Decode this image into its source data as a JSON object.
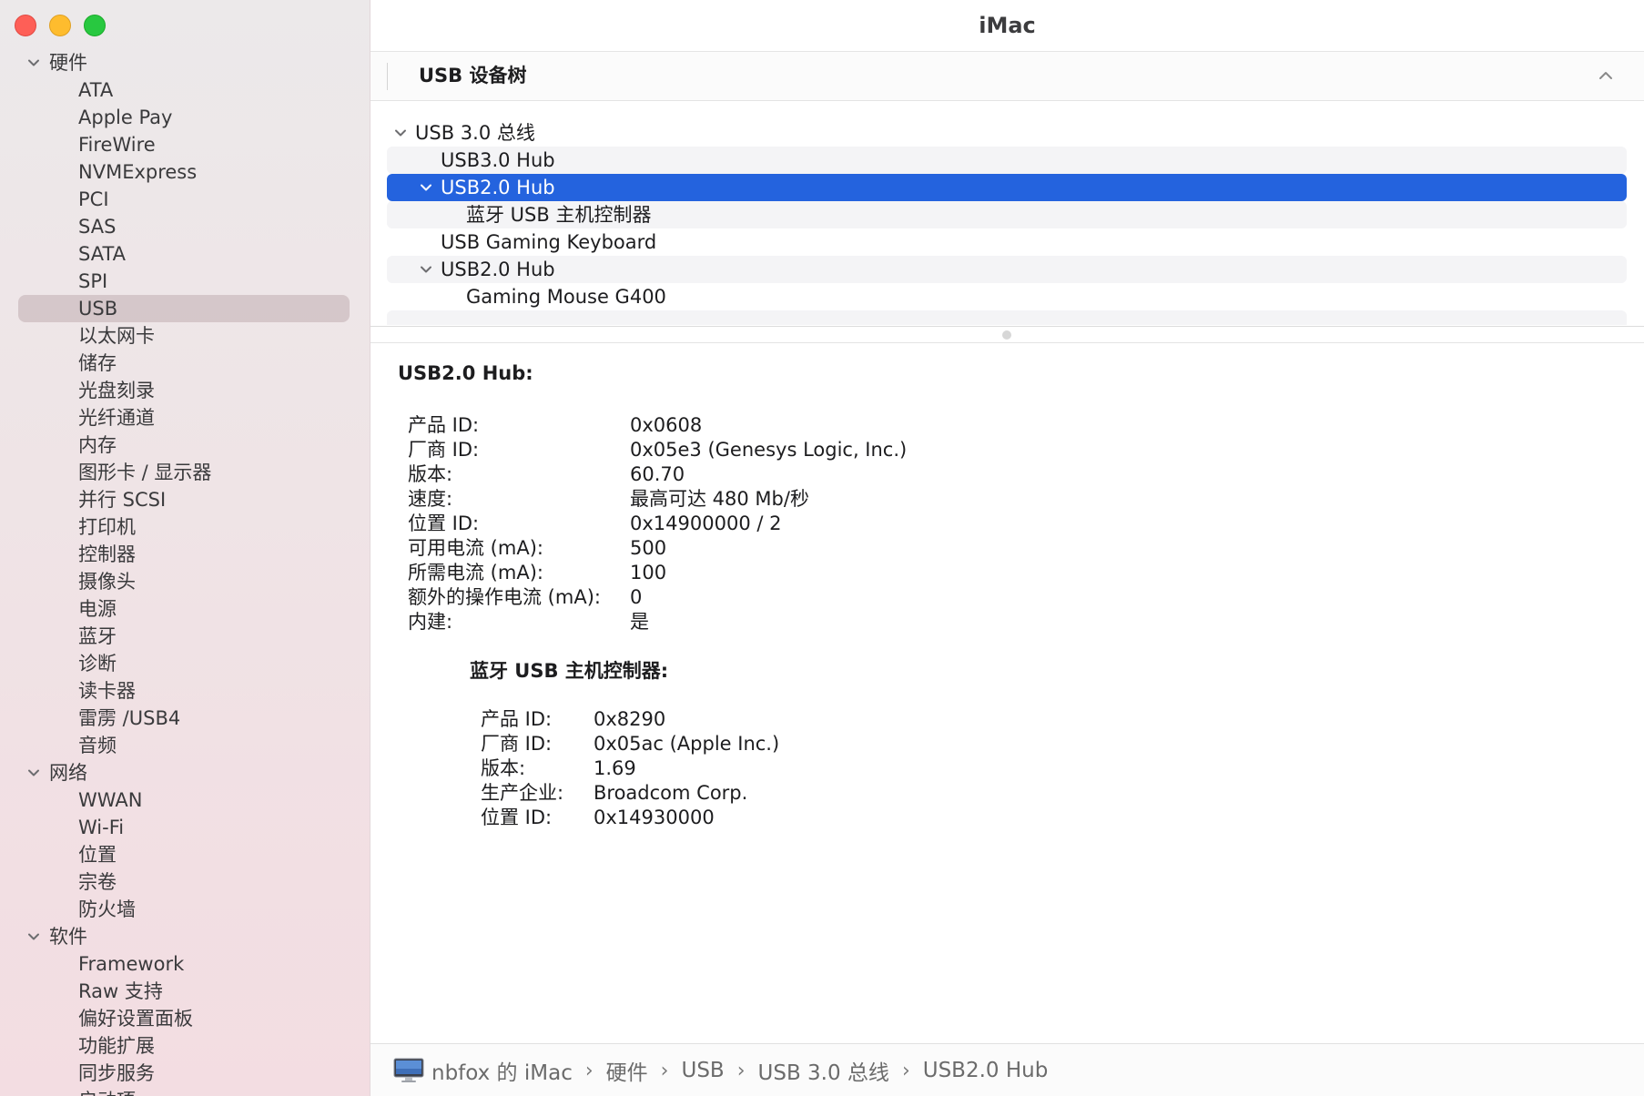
{
  "window": {
    "title": "iMac"
  },
  "sidebar": {
    "groups": [
      {
        "label": "硬件",
        "items": [
          "ATA",
          "Apple Pay",
          "FireWire",
          "NVMExpress",
          "PCI",
          "SAS",
          "SATA",
          "SPI",
          "USB",
          "以太网卡",
          "储存",
          "光盘刻录",
          "光纤通道",
          "内存",
          "图形卡 / 显示器",
          "并行 SCSI",
          "打印机",
          "控制器",
          "摄像头",
          "电源",
          "蓝牙",
          "诊断",
          "读卡器",
          "雷雳 /USB4",
          "音频"
        ]
      },
      {
        "label": "网络",
        "items": [
          "WWAN",
          "Wi-Fi",
          "位置",
          "宗卷",
          "防火墙"
        ]
      },
      {
        "label": "软件",
        "items": [
          "Framework",
          "Raw 支持",
          "偏好设置面板",
          "功能扩展",
          "同步服务",
          "启动项"
        ]
      }
    ],
    "selected": "USB"
  },
  "section": {
    "title": "USB 设备树"
  },
  "tree": {
    "rows": [
      {
        "label": "USB 3.0 总线",
        "level": 0,
        "expanded": true
      },
      {
        "label": "USB3.0 Hub",
        "level": 1
      },
      {
        "label": "USB2.0 Hub",
        "level": 1,
        "expanded": true,
        "selected": true
      },
      {
        "label": "蓝牙 USB 主机控制器",
        "level": 2
      },
      {
        "label": "USB Gaming Keyboard",
        "level": 1
      },
      {
        "label": "USB2.0 Hub",
        "level": 1,
        "expanded": true
      },
      {
        "label": "Gaming Mouse G400",
        "level": 2
      },
      {
        "label": "",
        "level": 2
      }
    ]
  },
  "detail": {
    "heading": "USB2.0 Hub:",
    "properties": [
      {
        "key": "产品 ID:",
        "value": "0x0608"
      },
      {
        "key": "厂商 ID:",
        "value": "0x05e3  (Genesys Logic, Inc.)"
      },
      {
        "key": "版本:",
        "value": "60.70"
      },
      {
        "key": "速度:",
        "value": "最高可达 480 Mb/秒"
      },
      {
        "key": "位置 ID:",
        "value": "0x14900000 / 2"
      },
      {
        "key": "可用电流 (mA):",
        "value": "500"
      },
      {
        "key": "所需电流 (mA):",
        "value": "100"
      },
      {
        "key": "额外的操作电流 (mA):",
        "value": "0"
      },
      {
        "key": "内建:",
        "value": "是"
      }
    ],
    "child": {
      "heading": "蓝牙 USB 主机控制器:",
      "properties": [
        {
          "key": "产品 ID:",
          "value": "0x8290"
        },
        {
          "key": "厂商 ID:",
          "value": "0x05ac (Apple Inc.)"
        },
        {
          "key": "版本:",
          "value": "1.69"
        },
        {
          "key": "生产企业:",
          "value": "Broadcom Corp."
        },
        {
          "key": "位置 ID:",
          "value": "0x14930000"
        }
      ]
    }
  },
  "pathbar": {
    "icon": "imac-icon",
    "crumbs": [
      "nbfox 的 iMac",
      "硬件",
      "USB",
      "USB 3.0 总线",
      "USB2.0 Hub"
    ]
  },
  "colors": {
    "accent": "#2463de",
    "close": "#fe5f57",
    "minimize": "#febc2e",
    "zoom": "#28c840"
  }
}
